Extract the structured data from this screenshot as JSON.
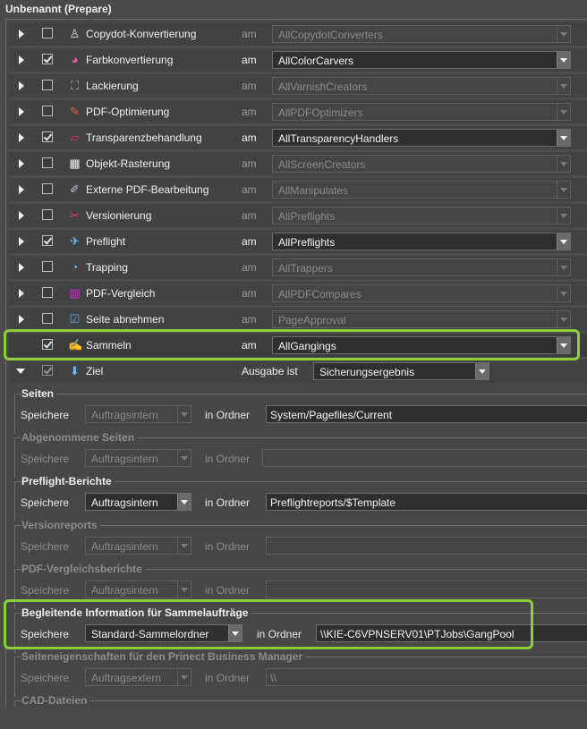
{
  "panel": {
    "title": "Unbenannt (Prepare)"
  },
  "steps": [
    {
      "label": "Copydot-Konvertierung",
      "icon": "copydot-icon",
      "glyph": "♙",
      "checked": false,
      "enabled": false,
      "am": "am",
      "value": "AllCopydotConverters"
    },
    {
      "label": "Farbkonvertierung",
      "icon": "color-convert-icon",
      "glyph": "◕",
      "checked": true,
      "enabled": true,
      "am": "am",
      "value": "AllColorCarvers"
    },
    {
      "label": "Lackierung",
      "icon": "varnish-icon",
      "glyph": "⛶",
      "checked": false,
      "enabled": false,
      "am": "am",
      "value": "AllVarnishCreators"
    },
    {
      "label": "PDF-Optimierung",
      "icon": "pdf-optimize-icon",
      "glyph": "✎",
      "checked": false,
      "enabled": false,
      "am": "am",
      "value": "AllPDFOptimizers"
    },
    {
      "label": "Transparenzbehandlung",
      "icon": "transparency-icon",
      "glyph": "▱",
      "checked": true,
      "enabled": true,
      "am": "am",
      "value": "AllTransparencyHandlers"
    },
    {
      "label": "Objekt-Rasterung",
      "icon": "rasterize-icon",
      "glyph": "▦",
      "checked": false,
      "enabled": false,
      "am": "am",
      "value": "AllScreenCreators"
    },
    {
      "label": "Externe PDF-Bearbeitung",
      "icon": "external-pdf-icon",
      "glyph": "✐",
      "checked": false,
      "enabled": false,
      "am": "am",
      "value": "AllManipulates"
    },
    {
      "label": "Versionierung",
      "icon": "versioning-icon",
      "glyph": "✂",
      "checked": false,
      "enabled": false,
      "am": "am",
      "value": "AllPreflights"
    },
    {
      "label": "Preflight",
      "icon": "preflight-icon",
      "glyph": "✈",
      "checked": true,
      "enabled": true,
      "am": "am",
      "value": "AllPreflights"
    },
    {
      "label": "Trapping",
      "icon": "trapping-icon",
      "glyph": "◔",
      "checked": false,
      "enabled": false,
      "am": "am",
      "value": "AllTrappers"
    },
    {
      "label": "PDF-Vergleich",
      "icon": "pdf-compare-icon",
      "glyph": "▥",
      "checked": false,
      "enabled": false,
      "am": "am",
      "value": "AllPDFCompares"
    },
    {
      "label": "Seite abnehmen",
      "icon": "page-approve-icon",
      "glyph": "☑",
      "checked": false,
      "enabled": false,
      "am": "am",
      "value": "PageApproval"
    },
    {
      "label": "Sammeln",
      "icon": "gang-icon",
      "glyph": "✍",
      "checked": true,
      "enabled": true,
      "am": "am",
      "value": "AllGangings"
    }
  ],
  "target": {
    "label": "Ziel",
    "icon": "download-arrow-icon",
    "glyph": "⬇",
    "output_label": "Ausgabe ist",
    "output_value": "Sicherungsergebnis"
  },
  "sections": [
    {
      "title": "Seiten",
      "enabled": true,
      "store": "Speichere",
      "mode": "Auftragsintern",
      "mode_on": false,
      "folder_label": "in Ordner",
      "folder": "System/Pagefiles/Current"
    },
    {
      "title": "Abgenommene Seiten",
      "enabled": false,
      "store": "Speichere",
      "mode": "Auftragsintern",
      "mode_on": false,
      "folder_label": "in Ordner",
      "folder": ""
    },
    {
      "title": "Preflight-Berichte",
      "enabled": true,
      "store": "Speichere",
      "mode": "Auftragsintern",
      "mode_on": true,
      "folder_label": "in Ordner",
      "folder": "Preflightreports/$Template"
    },
    {
      "title": "Versionreports",
      "enabled": false,
      "store": "Speichere",
      "mode": "Auftragsintern",
      "mode_on": false,
      "folder_label": "in Ordner",
      "folder": ""
    },
    {
      "title": "PDF-Vergleichsberichte",
      "enabled": false,
      "store": "Speichere",
      "mode": "Auftragsintern",
      "mode_on": false,
      "folder_label": "in Ordner",
      "folder": ""
    },
    {
      "title": "Begleitende Information für Sammelaufträge",
      "enabled": true,
      "store": "Speichere",
      "mode": "Standard-Sammelordner",
      "mode_on": true,
      "folder_label": "in Ordner",
      "folder": "\\\\KIE-C6VPNSERV01\\PTJobs\\GangPool"
    },
    {
      "title": "Seiteneigenschaften für den Prinect Business Manager",
      "enabled": false,
      "store": "Speichere",
      "mode": "Auftragsextern",
      "mode_on": false,
      "folder_label": "in Ordner",
      "folder": "\\\\"
    },
    {
      "title": "CAD-Dateien",
      "enabled": false
    }
  ],
  "colors": {
    "highlight": "#8ccf3b",
    "panel_bg": "#474747",
    "row_bg": "#424242"
  }
}
